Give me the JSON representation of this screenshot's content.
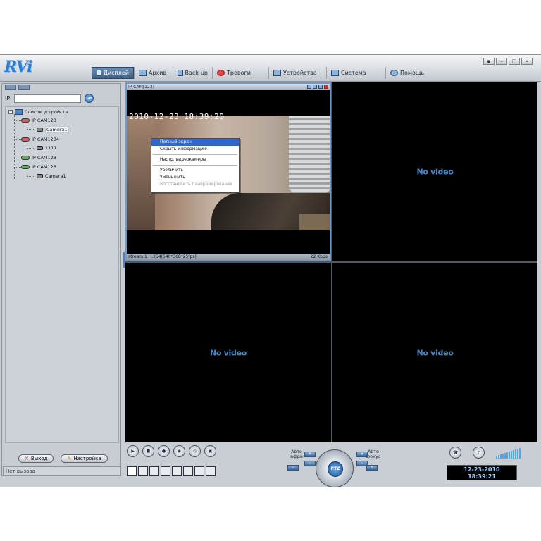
{
  "window": {
    "logo": "RVi",
    "controls": [
      "▪",
      "–",
      "□",
      "×"
    ]
  },
  "tabs": [
    {
      "label": "Дисплей",
      "icon": "monitor-icon",
      "active": true
    },
    {
      "label": "Архив",
      "icon": "grid-icon",
      "active": false
    },
    {
      "label": "Back-up",
      "icon": "backup-icon",
      "active": false
    },
    {
      "label": "Тревоги",
      "icon": "alarm-icon",
      "active": false
    },
    {
      "label": "Устройства",
      "icon": "device-icon",
      "active": false
    },
    {
      "label": "Система",
      "icon": "system-icon",
      "active": false
    },
    {
      "label": "Помощь",
      "icon": "help-icon",
      "active": false
    }
  ],
  "sidebar": {
    "ip_label": "IP:",
    "ip_value": "",
    "go_label": "Go",
    "tree": {
      "root": "Список устройств",
      "devices": [
        {
          "name": "IP CAM123",
          "status": "offline",
          "child": "Camera1"
        },
        {
          "name": "IP CAM1234",
          "status": "offline",
          "child": "1111"
        },
        {
          "name": "IP CAM123",
          "status": "online",
          "child": ""
        },
        {
          "name": "IP CAM123",
          "status": "online",
          "child": "Camera1"
        }
      ]
    },
    "exit_button": "Выход",
    "settings_button": "Настройка",
    "status_text": "Нет вызова"
  },
  "video": {
    "cam1": {
      "title": "IP CAM[123]",
      "timestamp": "2010-12-23 18:39:20",
      "stream_info": "stream:1 H.264(640*368*25fps)",
      "bitrate": "22 Kbps"
    },
    "no_video": "No video"
  },
  "context_menu": {
    "items": [
      {
        "label": "Полный экран",
        "state": "highlighted"
      },
      {
        "label": "Скрыть информацию",
        "state": "normal"
      },
      {
        "label": "Настр. видеокамеры",
        "state": "normal"
      },
      {
        "label": "Увеличить",
        "state": "normal"
      },
      {
        "label": "Уменьшить",
        "state": "normal"
      },
      {
        "label": "Восстановить панорамирование",
        "state": "disabled"
      }
    ]
  },
  "controls": {
    "auto_aperture": "Авто\nафра",
    "auto_focus": "Авто\nфокус",
    "ptz_center": "PTZ",
    "date": "12-23-2010",
    "time": "18:39:21"
  },
  "colors": {
    "accent": "#3266c8",
    "no_video": "#4a86c6",
    "clock_text": "#9bd0ff"
  }
}
